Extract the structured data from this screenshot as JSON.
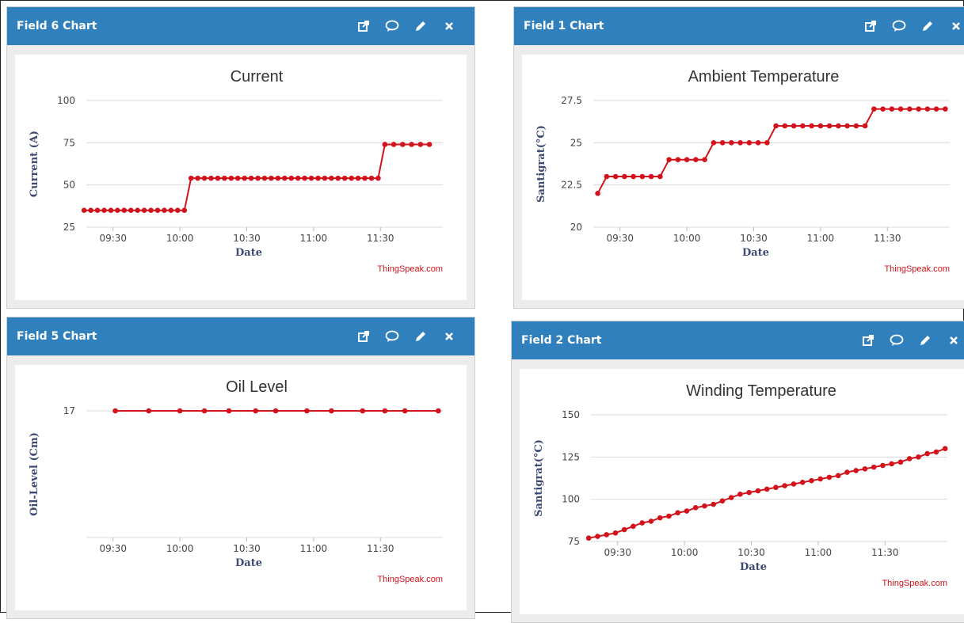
{
  "colors": {
    "header": "#2f80bd",
    "series": "#d3131b",
    "grid": "#d8d8d8"
  },
  "icons": [
    "external-link-icon",
    "comment-icon",
    "pencil-icon",
    "close-icon"
  ],
  "panels": [
    {
      "header": "Field 6 Chart",
      "credit": "ThingSpeak.com",
      "chart_data": {
        "type": "line",
        "title": "Current",
        "xlabel": "Date",
        "ylabel": "Current (A)",
        "ylim": [
          25,
          100
        ],
        "yticks": [
          "25",
          "50",
          "75",
          "100"
        ],
        "xlim": [
          "09:18",
          "11:58"
        ],
        "xticks": [
          "09:30",
          "10:00",
          "10:30",
          "11:00",
          "11:30"
        ],
        "series": [
          {
            "x": [
              "09:17",
              "09:20",
              "09:23",
              "09:26",
              "09:29",
              "09:32",
              "09:35",
              "09:38",
              "09:41",
              "09:44",
              "09:47",
              "09:50",
              "09:53",
              "09:56",
              "09:59",
              "10:02",
              "10:05",
              "10:08",
              "10:11",
              "10:14",
              "10:17",
              "10:20",
              "10:23",
              "10:26",
              "10:29",
              "10:32",
              "10:35",
              "10:38",
              "10:41",
              "10:44",
              "10:47",
              "10:50",
              "10:53",
              "10:56",
              "10:59",
              "11:02",
              "11:05",
              "11:08",
              "11:11",
              "11:14",
              "11:17",
              "11:20",
              "11:23",
              "11:26",
              "11:29",
              "11:32",
              "11:36",
              "11:40",
              "11:44",
              "11:48",
              "11:52"
            ],
            "y": [
              35,
              35,
              35,
              35,
              35,
              35,
              35,
              35,
              35,
              35,
              35,
              35,
              35,
              35,
              35,
              35,
              54,
              54,
              54,
              54,
              54,
              54,
              54,
              54,
              54,
              54,
              54,
              54,
              54,
              54,
              54,
              54,
              54,
              54,
              54,
              54,
              54,
              54,
              54,
              54,
              54,
              54,
              54,
              54,
              54,
              74,
              74,
              74,
              74,
              74,
              74
            ]
          }
        ]
      }
    },
    {
      "header": "Field 1 Chart",
      "credit": "ThingSpeak.com",
      "chart_data": {
        "type": "line",
        "title": "Ambient Temperature",
        "xlabel": "Date",
        "ylabel": "Santigrat(°C)",
        "ylim": [
          20,
          27.5
        ],
        "yticks": [
          "20",
          "22.5",
          "25",
          "27.5"
        ],
        "xlim": [
          "09:18",
          "11:58"
        ],
        "xticks": [
          "09:30",
          "10:00",
          "10:30",
          "11:00",
          "11:30"
        ],
        "series": [
          {
            "x": [
              "09:20",
              "09:24",
              "09:28",
              "09:32",
              "09:36",
              "09:40",
              "09:44",
              "09:48",
              "09:52",
              "09:56",
              "10:00",
              "10:04",
              "10:08",
              "10:12",
              "10:16",
              "10:20",
              "10:24",
              "10:28",
              "10:32",
              "10:36",
              "10:40",
              "10:44",
              "10:48",
              "10:52",
              "10:56",
              "11:00",
              "11:04",
              "11:08",
              "11:12",
              "11:16",
              "11:20",
              "11:24",
              "11:28",
              "11:32",
              "11:36",
              "11:40",
              "11:44",
              "11:48",
              "11:52",
              "11:56"
            ],
            "y": [
              22,
              23,
              23,
              23,
              23,
              23,
              23,
              23,
              24,
              24,
              24,
              24,
              24,
              25,
              25,
              25,
              25,
              25,
              25,
              25,
              26,
              26,
              26,
              26,
              26,
              26,
              26,
              26,
              26,
              26,
              26,
              27,
              27,
              27,
              27,
              27,
              27,
              27,
              27,
              27
            ]
          }
        ]
      }
    },
    {
      "header": "Field 5 Chart",
      "credit": "ThingSpeak.com",
      "chart_data": {
        "type": "line",
        "title": "Oil Level",
        "xlabel": "Date",
        "ylabel": "Oil-Level (Cm)",
        "ylim": [
          0,
          17
        ],
        "yticks": [
          "17"
        ],
        "xlim": [
          "09:18",
          "11:58"
        ],
        "xticks": [
          "09:30",
          "10:00",
          "10:30",
          "11:00",
          "11:30"
        ],
        "series": [
          {
            "x": [
              "09:31",
              "09:46",
              "10:00",
              "10:11",
              "10:22",
              "10:34",
              "10:43",
              "10:57",
              "11:08",
              "11:22",
              "11:32",
              "11:41",
              "11:56"
            ],
            "y": [
              17,
              17,
              17,
              17,
              17,
              17,
              17,
              17,
              17,
              17,
              17,
              17,
              17
            ]
          }
        ]
      }
    },
    {
      "header": "Field 2 Chart",
      "credit": "ThingSpeak.com",
      "chart_data": {
        "type": "line",
        "title": "Winding Temperature",
        "xlabel": "Date",
        "ylabel": "Santigrat(°C)",
        "ylim": [
          75,
          150
        ],
        "yticks": [
          "75",
          "100",
          "125",
          "150"
        ],
        "xlim": [
          "09:18",
          "11:58"
        ],
        "xticks": [
          "09:30",
          "10:00",
          "10:30",
          "11:00",
          "11:30"
        ],
        "series": [
          {
            "x": [
              "09:17",
              "09:21",
              "09:25",
              "09:29",
              "09:33",
              "09:37",
              "09:41",
              "09:45",
              "09:49",
              "09:53",
              "09:57",
              "10:01",
              "10:05",
              "10:09",
              "10:13",
              "10:17",
              "10:21",
              "10:25",
              "10:29",
              "10:33",
              "10:37",
              "10:41",
              "10:45",
              "10:49",
              "10:53",
              "10:57",
              "11:01",
              "11:05",
              "11:09",
              "11:13",
              "11:17",
              "11:21",
              "11:25",
              "11:29",
              "11:33",
              "11:37",
              "11:41",
              "11:45",
              "11:49",
              "11:53",
              "11:57"
            ],
            "y": [
              77,
              78,
              79,
              80,
              82,
              84,
              86,
              87,
              89,
              90,
              92,
              93,
              95,
              96,
              97,
              99,
              101,
              103,
              104,
              105,
              106,
              107,
              108,
              109,
              110,
              111,
              112,
              113,
              114,
              116,
              117,
              118,
              119,
              120,
              121,
              122,
              124,
              125,
              127,
              128,
              130
            ]
          }
        ]
      }
    }
  ]
}
